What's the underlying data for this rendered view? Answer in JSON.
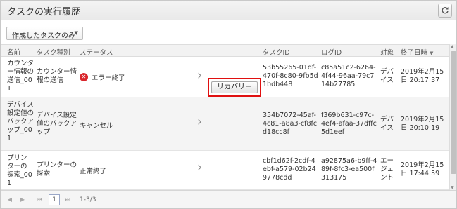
{
  "header": {
    "title": "タスクの実行履歴",
    "refresh_icon": "refresh-icon"
  },
  "filter": {
    "selected": "作成したタスクのみ"
  },
  "columns": {
    "name": "名前",
    "task_type": "タスク種別",
    "status": "ステータス",
    "task_id": "タスクID",
    "log_id": "ログID",
    "target": "対象",
    "end_time": "終了日時"
  },
  "rows": [
    {
      "name": "カウンター情報の送信_001",
      "task_type": "カウンター情報の送信",
      "status": "エラー終了",
      "status_icon": "error-icon",
      "action_label": "リカバリー",
      "task_id": "53b55265-01df-470f-8c80-9fb5d1bdb448",
      "log_id": "c85a51c2-6264-4f44-96aa-79c714b27785",
      "target": "デバイス",
      "end_time": "2019年2月15日 20:17:37"
    },
    {
      "name": "デバイス設定値のバックアップ_001",
      "task_type": "デバイス設定値のバックアップ",
      "status": "キャンセル",
      "task_id": "354b7072-45af-4c81-a8a3-cf8fcd18cc8f",
      "log_id": "f369b631-c97c-4ef4-afaa-37dffc5d1eef",
      "target": "デバイス",
      "end_time": "2019年2月15日 20:10:19"
    },
    {
      "name": "プリンターの探索_001",
      "task_type": "プリンターの探索",
      "status": "正常終了",
      "task_id": "cbf1d62f-2cdf-4ebf-a579-02b249778cdd",
      "log_id": "a92875a6-b9ff-489f-8fc3-ea500f313175",
      "target": "エージェント",
      "end_time": "2019年2月15日 17:44:59"
    }
  ],
  "pager": {
    "current_page": "1",
    "range": "1-3/3"
  }
}
